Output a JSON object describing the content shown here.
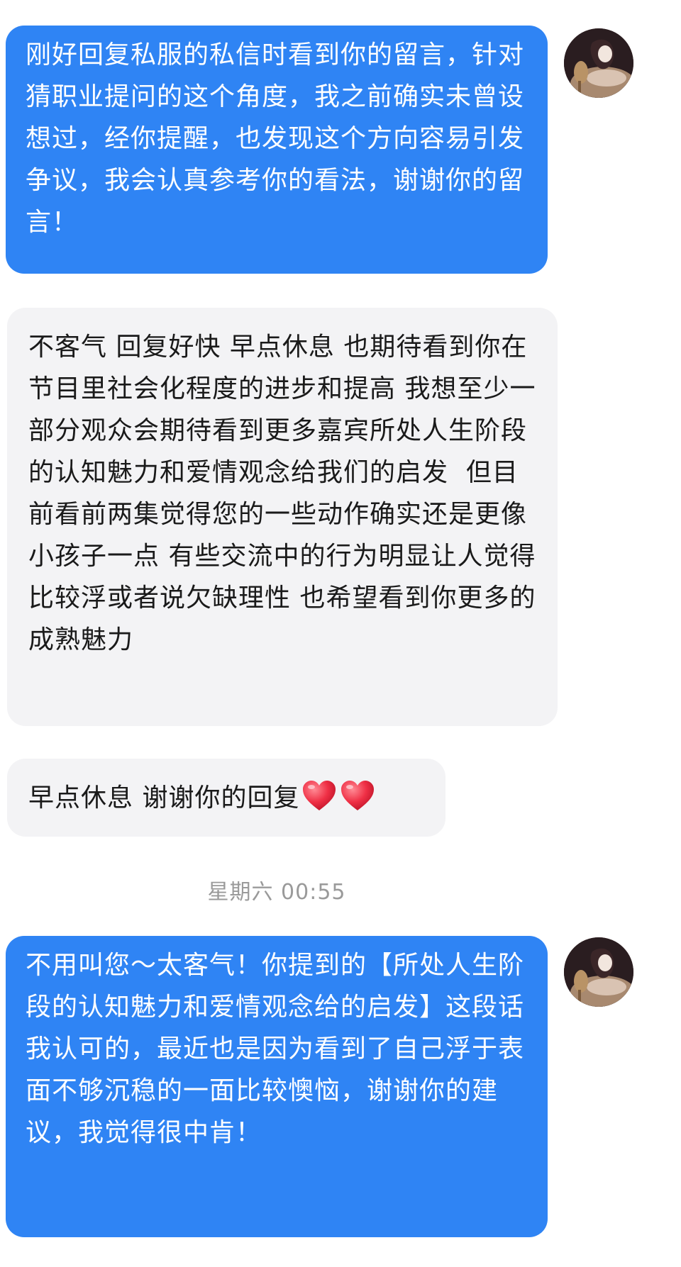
{
  "messages": [
    {
      "id": "m1",
      "side": "sent",
      "text": "刚好回复私服的私信时看到你的留言，针对猜职业提问的这个角度，我之前确实未曾设想过，经你提醒，也发现这个方向容易引发争议，我会认真参考你的看法，谢谢你的留言！"
    },
    {
      "id": "m2",
      "side": "received",
      "text": "不客气 回复好快 早点休息 也期待看到你在节目里社会化程度的进步和提高 我想至少一部分观众会期待看到更多嘉宾所处人生阶段的认知魅力和爱情观念给我们的启发  但目前看前两集觉得您的一些动作确实还是更像小孩子一点 有些交流中的行为明显让人觉得比较浮或者说欠缺理性 也希望看到你更多的成熟魅力"
    },
    {
      "id": "m3",
      "side": "received",
      "text": "早点休息 谢谢你的回复",
      "emoji": [
        "heart-emoji",
        "heart-emoji"
      ]
    },
    {
      "id": "m4",
      "side": "sent",
      "text": "不用叫您～太客气！你提到的【所处人生阶段的认知魅力和爱情观念给的启发】这段话我认可的，最近也是因为看到了自己浮于表面不够沉稳的一面比较懊恼，谢谢你的建议，我觉得很中肯！"
    }
  ],
  "timestamp": "星期六 00:55",
  "colors": {
    "sent_bubble": "#2f84f4",
    "received_bubble": "#f3f3f5",
    "timestamp_text": "#9a9a9a"
  }
}
